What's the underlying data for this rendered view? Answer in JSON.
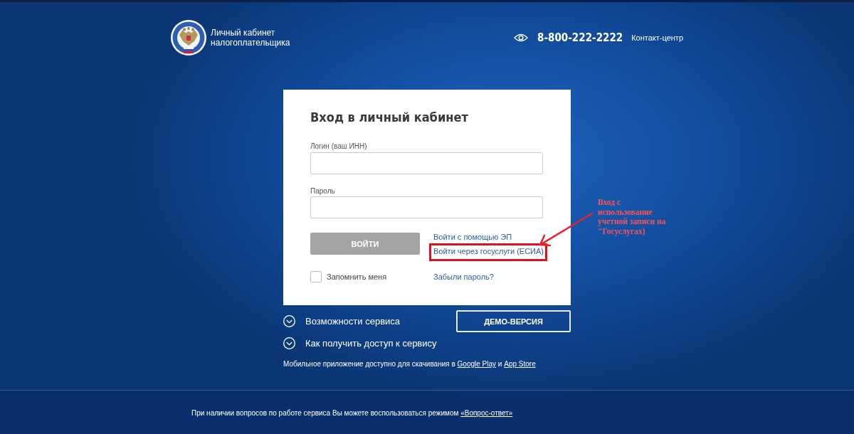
{
  "header": {
    "title": "Личный кабинет налогоплательщика",
    "phone": "8-800-222-2222",
    "phone_label": "Контакт-центр"
  },
  "login_card": {
    "title": "Вход в личный кабинет",
    "fields": [
      {
        "label": "Логин (ваш ИНН)"
      },
      {
        "label": "Пароль"
      }
    ],
    "submit": {
      "label": "ВОЙТИ",
      "disabled": true
    },
    "alt_logins": [
      {
        "label": "Войти с помощью ЭП",
        "highlighted": false
      },
      {
        "label": "Войти через госуслуги (ЕСИА)",
        "highlighted": true
      }
    ],
    "remember": {
      "label": "Запомнить меня",
      "checked": false
    },
    "forgot_link": "Забыли пароль?"
  },
  "info_links": [
    {
      "label": "Возможности сервиса",
      "expanded": false
    },
    {
      "label": "Как получить доступ к сервису",
      "expanded": false
    }
  ],
  "demo_button": "ДЕМО-ВЕРСИЯ",
  "mobile_note": [
    {
      "kind": "text",
      "text": "Мобильное приложение доступно для скачивания в"
    },
    {
      "kind": "link",
      "text": "Google Play"
    },
    {
      "kind": "text",
      "text": "и"
    },
    {
      "kind": "link",
      "text": "App Store"
    }
  ],
  "footer": [
    {
      "kind": "text",
      "text": "При наличии вопросов по работе сервиса Вы можете воспользоваться режимом"
    },
    {
      "kind": "link",
      "text": "«Вопрос-ответ»"
    }
  ],
  "annotation": {
    "lines": [
      "Вход с",
      "использование",
      "учетной записи на",
      "\"Госуслугах)"
    ]
  }
}
